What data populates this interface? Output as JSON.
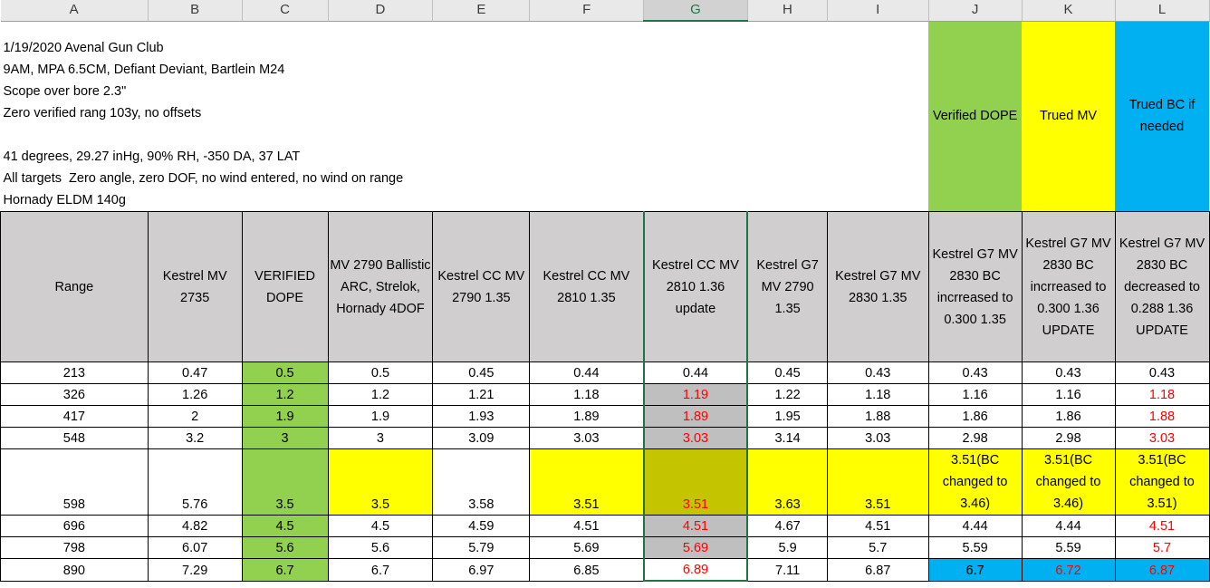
{
  "columns": [
    "A",
    "B",
    "C",
    "D",
    "E",
    "F",
    "G",
    "H",
    "I",
    "J",
    "K",
    "L"
  ],
  "notes": [
    "1/19/2020 Avenal Gun Club",
    "9AM, MPA 6.5CM, Defiant Deviant, Bartlein M24",
    "Scope over bore 2.3\"",
    "Zero verified rang 103y, no offsets",
    "",
    "41 degrees, 29.27 inHg, 90% RH, -350 DA, 37 LAT",
    "All targets  Zero angle, zero DOF, no wind entered, no wind on range",
    "Hornady ELDM 140g"
  ],
  "legend": {
    "verified": "Verified DOPE",
    "trued_mv": "Trued MV",
    "trued_bc": "Trued BC if needed",
    "colors": {
      "green": "#92d050",
      "yellow": "#ffff00",
      "blue": "#00b0f0",
      "gray": "#d0cece",
      "red_text": "#ff0000"
    }
  },
  "headers": [
    "Range",
    "Kestrel MV 2735",
    "VERIFIED DOPE",
    "MV 2790 Ballistic ARC, Strelok, Hornady 4DOF",
    "Kestrel CC MV 2790 1.35",
    "Kestrel CC MV 2810 1.35",
    "Kestrel CC MV 2810 1.36 update",
    "Kestrel G7 MV 2790 1.35",
    "Kestrel G7 MV 2830 1.35",
    "Kestrel G7 MV 2830 BC incrreased to 0.300 1.35",
    "Kestrel G7 MV 2830 BC incrreased to 0.300 1.36 UPDATE",
    "Kestrel G7 MV 2830 BC decreased to 0.288 1.36 UPDATE"
  ],
  "rows": [
    [
      "213",
      "0.47",
      "0.5",
      "0.5",
      "0.45",
      "0.44",
      "0.44",
      "0.45",
      "0.43",
      "0.43",
      "0.43",
      "0.43"
    ],
    [
      "326",
      "1.26",
      "1.2",
      "1.2",
      "1.21",
      "1.18",
      "1.19",
      "1.22",
      "1.18",
      "1.16",
      "1.16",
      "1.18"
    ],
    [
      "417",
      "2",
      "1.9",
      "1.9",
      "1.93",
      "1.89",
      "1.89",
      "1.95",
      "1.88",
      "1.86",
      "1.86",
      "1.88"
    ],
    [
      "548",
      "3.2",
      "3",
      "3",
      "3.09",
      "3.03",
      "3.03",
      "3.14",
      "3.03",
      "2.98",
      "2.98",
      "3.03"
    ],
    [
      "598",
      "5.76",
      "3.5",
      "3.5",
      "3.58",
      "3.51",
      "3.51",
      "3.63",
      "3.51",
      "3.51(BC changed to 3.46)",
      "3.51(BC changed to 3.46)",
      "3.51(BC changed to 3.51)"
    ],
    [
      "696",
      "4.82",
      "4.5",
      "4.5",
      "4.59",
      "4.51",
      "4.51",
      "4.67",
      "4.51",
      "4.44",
      "4.44",
      "4.51"
    ],
    [
      "798",
      "6.07",
      "5.6",
      "5.6",
      "5.79",
      "5.69",
      "5.69",
      "5.9",
      "5.7",
      "5.59",
      "5.59",
      "5.7"
    ],
    [
      "890",
      "7.29",
      "6.7",
      "6.7",
      "6.97",
      "6.85",
      "6.89",
      "7.11",
      "6.87",
      "6.7",
      "6.72",
      "6.87"
    ]
  ],
  "selected_column": "G"
}
